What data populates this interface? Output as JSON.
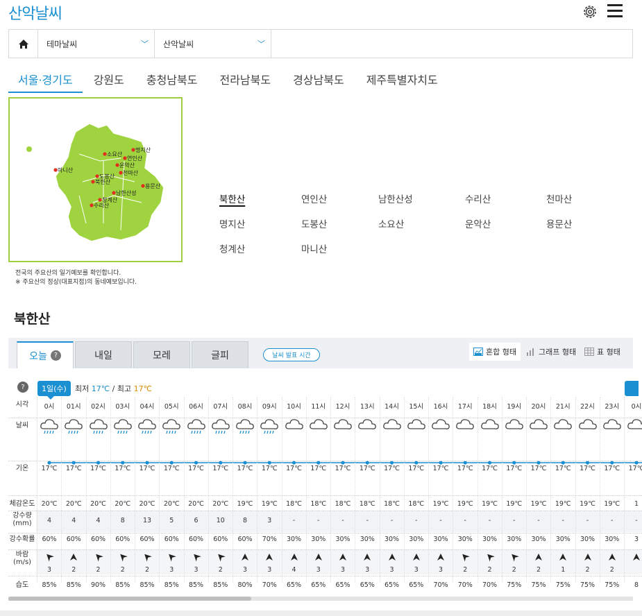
{
  "app": {
    "title": "산악날씨"
  },
  "nav": {
    "theme_label": "테마날씨",
    "sub_label": "산악날씨"
  },
  "region_tabs": [
    "서울·경기도",
    "강원도",
    "충청남북도",
    "전라남북도",
    "경상남북도",
    "제주특별자치도"
  ],
  "map": {
    "labels": [
      "소요산",
      "명지산",
      "연인산",
      "운악산",
      "천마산",
      "마니산",
      "도봉산",
      "북한산",
      "용문산",
      "남한산성",
      "청계산",
      "수리산"
    ],
    "notes": [
      "전국의 주요산의 일기예보를 확인합니다.",
      "※ 주요산의 정상(대표지점)의 동네예보입니다."
    ]
  },
  "mountains": [
    "북한산",
    "연인산",
    "남한산성",
    "수리산",
    "천마산",
    "명지산",
    "도봉산",
    "소요산",
    "운악산",
    "용문산",
    "청계산",
    "마니산"
  ],
  "selected_mountain": "북한산",
  "day_tabs": {
    "today": "오늘",
    "tomorrow": "내일",
    "day_after": "모레",
    "glpi": "글피",
    "help": "?"
  },
  "publish_time_btn": "날씨 발표 시간",
  "view_modes": [
    "혼합 형태",
    "그래프 형태",
    "표 형태"
  ],
  "date": {
    "badge": "1일(수)",
    "min_label": "최저",
    "min": "17℃",
    "sep": "/",
    "max_label": "최고",
    "max": "17℃",
    "help": "?"
  },
  "row_labels": {
    "time": "시각",
    "weather": "날씨",
    "temp": "기온",
    "feel": "체감온도",
    "precip": "강수량",
    "precip_unit": "(mm)",
    "prob": "강수확률",
    "wind": "바람",
    "wind_unit": "(m/s)",
    "humidity": "습도"
  },
  "forecast": {
    "hours": [
      "0시",
      "01시",
      "02시",
      "03시",
      "04시",
      "05시",
      "06시",
      "07시",
      "08시",
      "09시",
      "10시",
      "11시",
      "12시",
      "13시",
      "14시",
      "15시",
      "16시",
      "17시",
      "18시",
      "19시",
      "20시",
      "21시",
      "22시",
      "23시",
      "0시"
    ],
    "weather": [
      "rain",
      "rain",
      "rain",
      "rain",
      "rain",
      "rain",
      "rain",
      "rain",
      "rain",
      "rain",
      "cloud",
      "cloud",
      "cloud",
      "cloud",
      "cloud",
      "cloud",
      "cloud",
      "cloud",
      "cloud",
      "cloud",
      "cloud",
      "cloud",
      "cloud",
      "cloud",
      "cloud"
    ],
    "temp": [
      "17℃",
      "17℃",
      "17℃",
      "17℃",
      "17℃",
      "17℃",
      "17℃",
      "17℃",
      "17℃",
      "17℃",
      "17℃",
      "17℃",
      "17℃",
      "17℃",
      "17℃",
      "17℃",
      "17℃",
      "17℃",
      "17℃",
      "17℃",
      "17℃",
      "17℃",
      "17℃",
      "17℃",
      "17℃"
    ],
    "temp_values": [
      17,
      17,
      17,
      17,
      17,
      17,
      17,
      17,
      17,
      17,
      17,
      17,
      17,
      17,
      17,
      17,
      17,
      17,
      17,
      17,
      17,
      17,
      17,
      17,
      17
    ],
    "feel": [
      "20℃",
      "20℃",
      "20℃",
      "20℃",
      "20℃",
      "20℃",
      "20℃",
      "20℃",
      "19℃",
      "19℃",
      "18℃",
      "18℃",
      "18℃",
      "18℃",
      "18℃",
      "18℃",
      "19℃",
      "19℃",
      "19℃",
      "19℃",
      "19℃",
      "19℃",
      "19℃",
      "19℃",
      "1"
    ],
    "precip": [
      "4",
      "4",
      "4",
      "8",
      "13",
      "5",
      "6",
      "10",
      "8",
      "3",
      "-",
      "-",
      "-",
      "-",
      "-",
      "-",
      "-",
      "-",
      "-",
      "-",
      "-",
      "-",
      "-",
      "-",
      "-"
    ],
    "prob": [
      "60%",
      "60%",
      "60%",
      "60%",
      "60%",
      "60%",
      "60%",
      "60%",
      "60%",
      "70%",
      "30%",
      "30%",
      "30%",
      "30%",
      "30%",
      "30%",
      "30%",
      "30%",
      "30%",
      "30%",
      "30%",
      "30%",
      "30%",
      "30%",
      "3"
    ],
    "wind_dir": [
      225,
      270,
      225,
      225,
      225,
      225,
      225,
      225,
      270,
      270,
      270,
      270,
      270,
      270,
      270,
      270,
      270,
      225,
      225,
      225,
      270,
      270,
      270,
      270,
      270
    ],
    "wind_speed": [
      "3",
      "2",
      "2",
      "2",
      "2",
      "3",
      "3",
      "2",
      "3",
      "3",
      "4",
      "3",
      "3",
      "3",
      "3",
      "3",
      "3",
      "2",
      "2",
      "2",
      "2",
      "1",
      "2",
      "2",
      ""
    ],
    "humidity": [
      "85%",
      "85%",
      "90%",
      "85%",
      "85%",
      "85%",
      "85%",
      "85%",
      "80%",
      "70%",
      "65%",
      "65%",
      "65%",
      "65%",
      "65%",
      "65%",
      "70%",
      "70%",
      "70%",
      "75%",
      "75%",
      "75%",
      "75%",
      "75%",
      "8"
    ]
  },
  "colors": {
    "accent": "#1a8fd1",
    "map_fill": "#9fd33f",
    "map_border": "#9fcf3e",
    "max_temp": "#e08a00"
  }
}
